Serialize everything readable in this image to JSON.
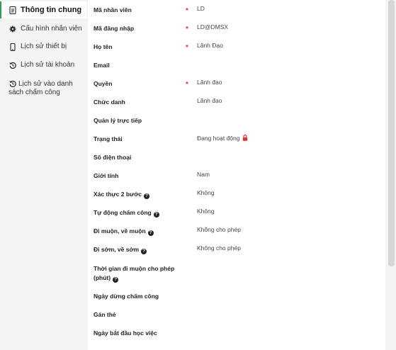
{
  "sidebar": {
    "items": [
      {
        "label": "Thông tin chung",
        "icon": "document-icon",
        "active": true
      },
      {
        "label": "Cấu hình nhân viên",
        "icon": "gear-icon"
      },
      {
        "label": "Lịch sử thiết bị",
        "icon": "mobile-icon"
      },
      {
        "label": "Lịch sử tài khoản",
        "icon": "history-icon"
      },
      {
        "label": "Lịch sử vào danh sách chấm công",
        "icon": "history-icon"
      }
    ]
  },
  "form": {
    "fields": [
      {
        "label": "Mã nhân viên",
        "required": true,
        "value": "LD"
      },
      {
        "label": "Mã đăng nhập",
        "required": true,
        "value": "LD@DMSX"
      },
      {
        "label": "Họ tên",
        "required": true,
        "value": "Lãnh Đạo"
      },
      {
        "label": "Email",
        "value": ""
      },
      {
        "label": "Quyền",
        "required": true,
        "value": "Lãnh đạo"
      },
      {
        "label": "Chức danh",
        "value": "Lãnh đạo"
      },
      {
        "label": "Quản lý trực tiếp",
        "value": ""
      },
      {
        "label": "Trạng thái",
        "value": "Đang hoạt động",
        "icon": "lock-icon"
      },
      {
        "label": "Số điện thoại",
        "value": ""
      },
      {
        "label": "Giới tính",
        "value": "Nam"
      },
      {
        "label": "Xác thực 2 bước",
        "help": true,
        "value": "Không"
      },
      {
        "label": "Tự động chấm công",
        "help": true,
        "value": "Không"
      },
      {
        "label": "Đi muộn, về muộn",
        "help": true,
        "value": "Không cho phép"
      },
      {
        "label": "Đi sớm, về sớm",
        "help": true,
        "value": "Không cho phép"
      },
      {
        "label": "Thời gian đi muộn cho phép (phút)",
        "help": true,
        "value": ""
      },
      {
        "label": "Ngày dừng chấm công",
        "value": ""
      },
      {
        "label": "Gán thẻ",
        "value": ""
      },
      {
        "label": "Ngày bắt đầu học việc",
        "value": ""
      }
    ]
  },
  "colors": {
    "accent": "#2f9e5b",
    "required": "#e23232",
    "lock": "#e23232"
  }
}
